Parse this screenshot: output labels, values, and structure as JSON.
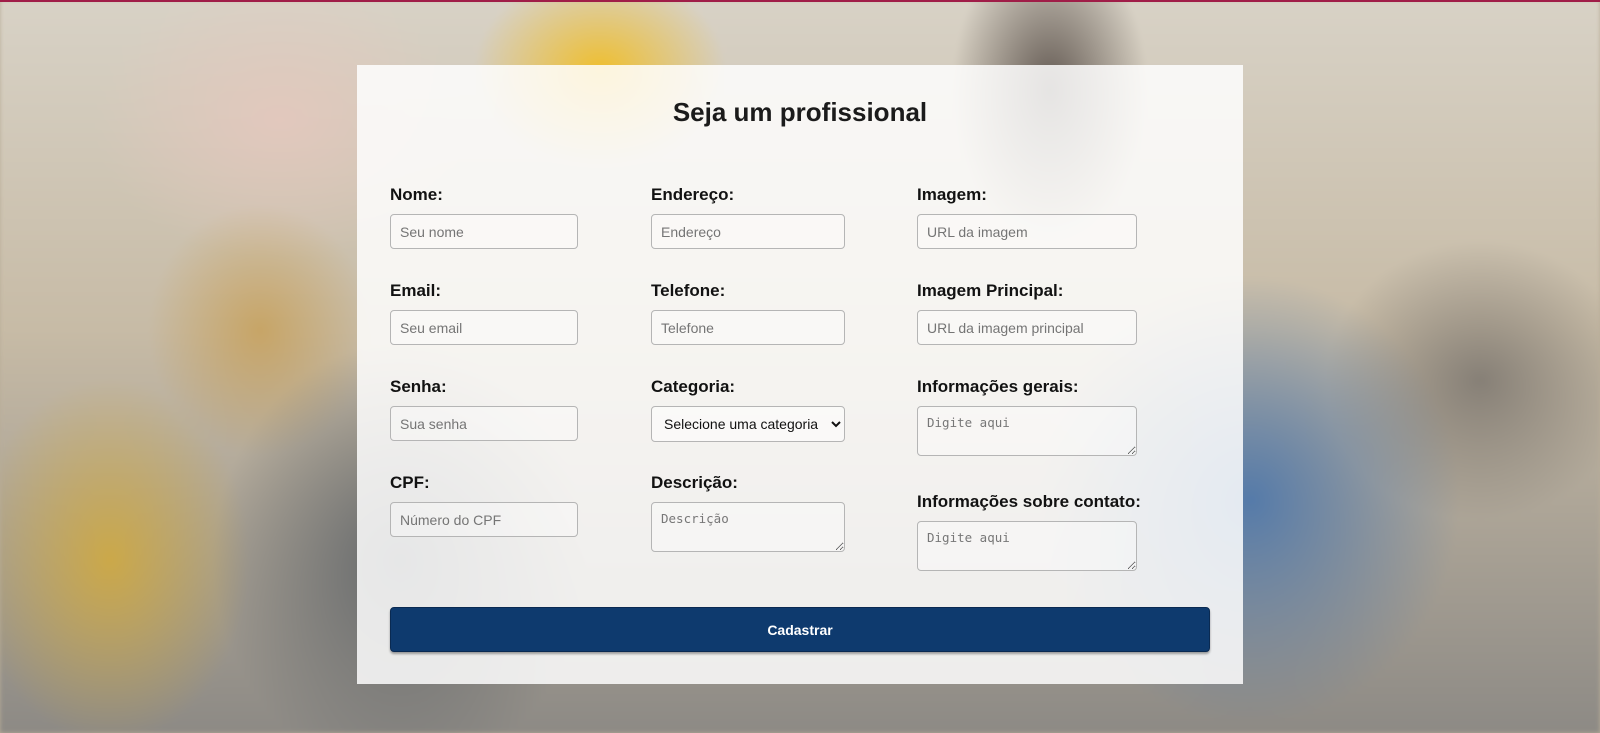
{
  "form": {
    "title": "Seja um profissional",
    "fields": {
      "nome": {
        "label": "Nome:",
        "placeholder": "Seu nome"
      },
      "email": {
        "label": "Email:",
        "placeholder": "Seu email"
      },
      "senha": {
        "label": "Senha:",
        "placeholder": "Sua senha"
      },
      "cpf": {
        "label": "CPF:",
        "placeholder": "Número do CPF"
      },
      "endereco": {
        "label": "Endereço:",
        "placeholder": "Endereço"
      },
      "telefone": {
        "label": "Telefone:",
        "placeholder": "Telefone"
      },
      "categoria": {
        "label": "Categoria:",
        "selected": "Selecione uma categoria"
      },
      "descricao": {
        "label": "Descrição:",
        "placeholder": "Descrição"
      },
      "imagem": {
        "label": "Imagem:",
        "placeholder": "URL da imagem"
      },
      "imagem_principal": {
        "label": "Imagem Principal:",
        "placeholder": "URL da imagem principal"
      },
      "informacoes_gerais": {
        "label": "Informações gerais:",
        "placeholder": "Digite aqui"
      },
      "informacoes_contato": {
        "label": "Informações sobre contato:",
        "placeholder": "Digite aqui"
      }
    },
    "submit_label": "Cadastrar"
  },
  "colors": {
    "accent": "#0e3a6e",
    "top_bar": "#a01d48"
  }
}
